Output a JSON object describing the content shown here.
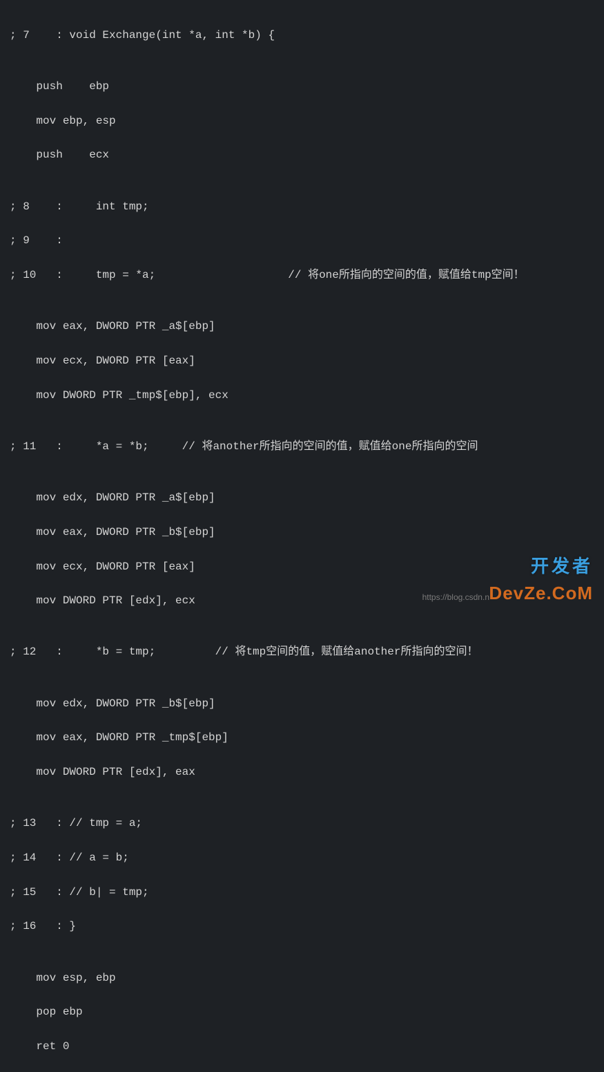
{
  "lines": {
    "l01": "; 7    : void Exchange(int *a, int *b) {",
    "l02": "",
    "l03": "    push    ebp",
    "l04": "    mov ebp, esp",
    "l05": "    push    ecx",
    "l06": "",
    "l07": "; 8    :     int tmp;",
    "l08": "; 9    : ",
    "l09": "; 10   :     tmp = *a;                    // 将one所指向的空间的值，赋值给tmp空间！",
    "l10": "",
    "l11": "    mov eax, DWORD PTR _a$[ebp]",
    "l12": "    mov ecx, DWORD PTR [eax]",
    "l13": "    mov DWORD PTR _tmp$[ebp], ecx",
    "l14": "",
    "l15": "; 11   :     *a = *b;     // 将another所指向的空间的值，赋值给one所指向的空间",
    "l16": "",
    "l17": "    mov edx, DWORD PTR _a$[ebp]",
    "l18": "    mov eax, DWORD PTR _b$[ebp]",
    "l19": "    mov ecx, DWORD PTR [eax]",
    "l20": "    mov DWORD PTR [edx], ecx",
    "l21": "",
    "l22": "; 12   :     *b = tmp;         // 将tmp空间的值，赋值给another所指向的空间！",
    "l23": "",
    "l24": "    mov edx, DWORD PTR _b$[ebp]",
    "l25": "    mov eax, DWORD PTR _tmp$[ebp]",
    "l26": "    mov DWORD PTR [edx], eax",
    "l27": "",
    "l28": "; 13   : // tmp = a;",
    "l29": "; 14   : // a = b;",
    "l30": "; 15   : // b| = tmp;",
    "l31": "; 16   : }",
    "l32": "",
    "l33": "    mov esp, ebp",
    "l34": "    pop ebp",
    "l35": "    ret 0"
  },
  "watermark": {
    "cn": "开发者",
    "en": "DevZe.CoM",
    "url": "https://blog.csdn.n"
  }
}
